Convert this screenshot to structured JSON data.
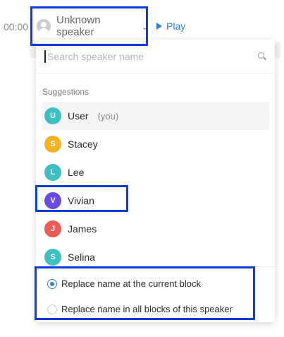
{
  "transcript_row": {
    "timestamp": "00:00",
    "speaker_label": "Unknown speaker",
    "play_label": "Play"
  },
  "speaker_picker": {
    "search_placeholder": "Search speaker name",
    "section_label": "Suggestions",
    "suggestions": [
      {
        "initial": "U",
        "name": "User",
        "note": "(you)",
        "color": "#3bbfc1",
        "selected": true
      },
      {
        "initial": "S",
        "name": "Stacey",
        "note": "",
        "color": "#f5b324",
        "selected": false
      },
      {
        "initial": "L",
        "name": "Lee",
        "note": "",
        "color": "#3bbfc1",
        "selected": false
      },
      {
        "initial": "V",
        "name": "Vivian",
        "note": "",
        "color": "#6a4ae0",
        "selected": false
      },
      {
        "initial": "J",
        "name": "James",
        "note": "",
        "color": "#ef5a55",
        "selected": false
      },
      {
        "initial": "S",
        "name": "Selina",
        "note": "",
        "color": "#3bbfc1",
        "selected": false
      }
    ],
    "scope_options": [
      {
        "label": "Replace name at the current block",
        "checked": true
      },
      {
        "label": "Replace name in all blocks of this speaker",
        "checked": false
      }
    ]
  },
  "colors": {
    "accent": "#2f7fd6",
    "highlight_box": "#0a3ed6"
  }
}
